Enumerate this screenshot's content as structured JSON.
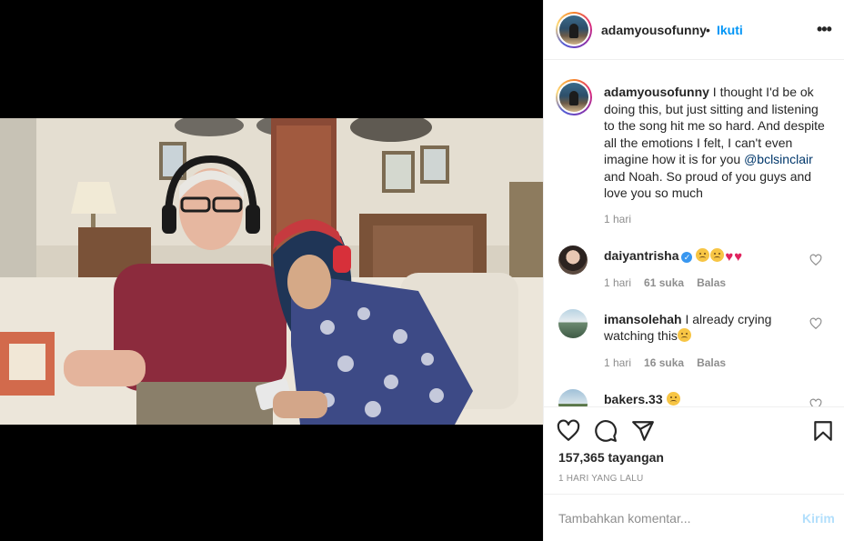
{
  "post": {
    "username": "adamyousofunny",
    "dot": "•",
    "follow_label": "Ikuti",
    "more_label": "•••",
    "caption": {
      "username": "adamyousofunny",
      "text_before": " I thought I'd be ok doing this, but just sitting and listening to the song hit me so hard. And despite all the emotions I felt, I can't even imagine how it is for you ",
      "mention": "@bclsinclair",
      "text_after": " and Noah. So proud of you guys and love you so much",
      "time": "1 hari"
    },
    "comments": [
      {
        "username": "daiyantrisha",
        "verified": true,
        "text": "",
        "emoji": [
          "sad-face",
          "sad-face",
          "red-heart",
          "red-heart"
        ],
        "time": "1 hari",
        "likes": "61 suka",
        "reply": "Balas"
      },
      {
        "username": "imansolehah",
        "verified": false,
        "text": "I already crying watching this",
        "emoji": [
          "sad-face"
        ],
        "time": "1 hari",
        "likes": "16 suka",
        "reply": "Balas"
      },
      {
        "username": "bakers.33",
        "verified": false,
        "text": "",
        "emoji": [
          "sad-face"
        ],
        "time": "",
        "likes": "",
        "reply": ""
      }
    ],
    "views": "157,365 tayangan",
    "posted_ago": "1 HARI YANG LALU",
    "composer": {
      "placeholder": "Tambahkan komentar...",
      "post_label": "Kirim"
    }
  },
  "icons": {
    "like": "heart-icon",
    "comment": "comment-icon",
    "share": "share-icon",
    "save": "bookmark-icon",
    "more": "more-icon",
    "comment_like": "heart-icon",
    "verified": "verified-badge-icon"
  },
  "colors": {
    "accent_blue": "#0095f6",
    "post_button_disabled": "#b2dffc",
    "mention": "#00376b",
    "muted_text": "#8e8e8e",
    "verified": "#3897f0",
    "heart_red": "#e0245e",
    "media_background": "#000000"
  }
}
